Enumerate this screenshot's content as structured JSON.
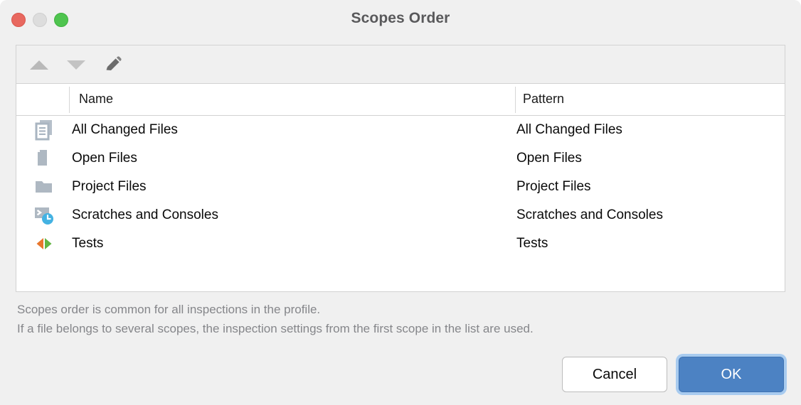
{
  "window": {
    "title": "Scopes Order",
    "traffic_lights": [
      {
        "name": "close",
        "color": "#e8685f"
      },
      {
        "name": "minimize",
        "color": "#dddddd"
      },
      {
        "name": "maximize",
        "color": "#4fc44f"
      }
    ]
  },
  "toolbar": {
    "move_up": {
      "icon": "arrow-up-icon",
      "enabled": false
    },
    "move_down": {
      "icon": "arrow-down-icon",
      "enabled": false
    },
    "edit": {
      "icon": "pencil-icon",
      "enabled": true
    }
  },
  "table": {
    "columns": [
      "",
      "Name",
      "Pattern"
    ],
    "rows": [
      {
        "icon": "all-changed-files-icon",
        "name": "All Changed Files",
        "pattern": "All Changed Files"
      },
      {
        "icon": "open-files-icon",
        "name": "Open Files",
        "pattern": "Open Files"
      },
      {
        "icon": "project-files-icon",
        "name": "Project Files",
        "pattern": "Project Files"
      },
      {
        "icon": "scratches-consoles-icon",
        "name": "Scratches and Consoles",
        "pattern": "Scratches and Consoles"
      },
      {
        "icon": "tests-icon",
        "name": "Tests",
        "pattern": "Tests"
      }
    ]
  },
  "note": {
    "line1": "Scopes order is common for all inspections in the profile.",
    "line2": "If a file belongs to several scopes, the inspection settings from the first scope in the list are used."
  },
  "footer": {
    "cancel_label": "Cancel",
    "ok_label": "OK"
  },
  "colors": {
    "accent": "#4c82c3",
    "focus_ring": "#a8cbef",
    "icon_gray": "#aeb8c2",
    "clock_blue": "#44b2e2",
    "test_orange": "#e8762c",
    "test_green": "#62b543",
    "note_text": "#85868a"
  }
}
